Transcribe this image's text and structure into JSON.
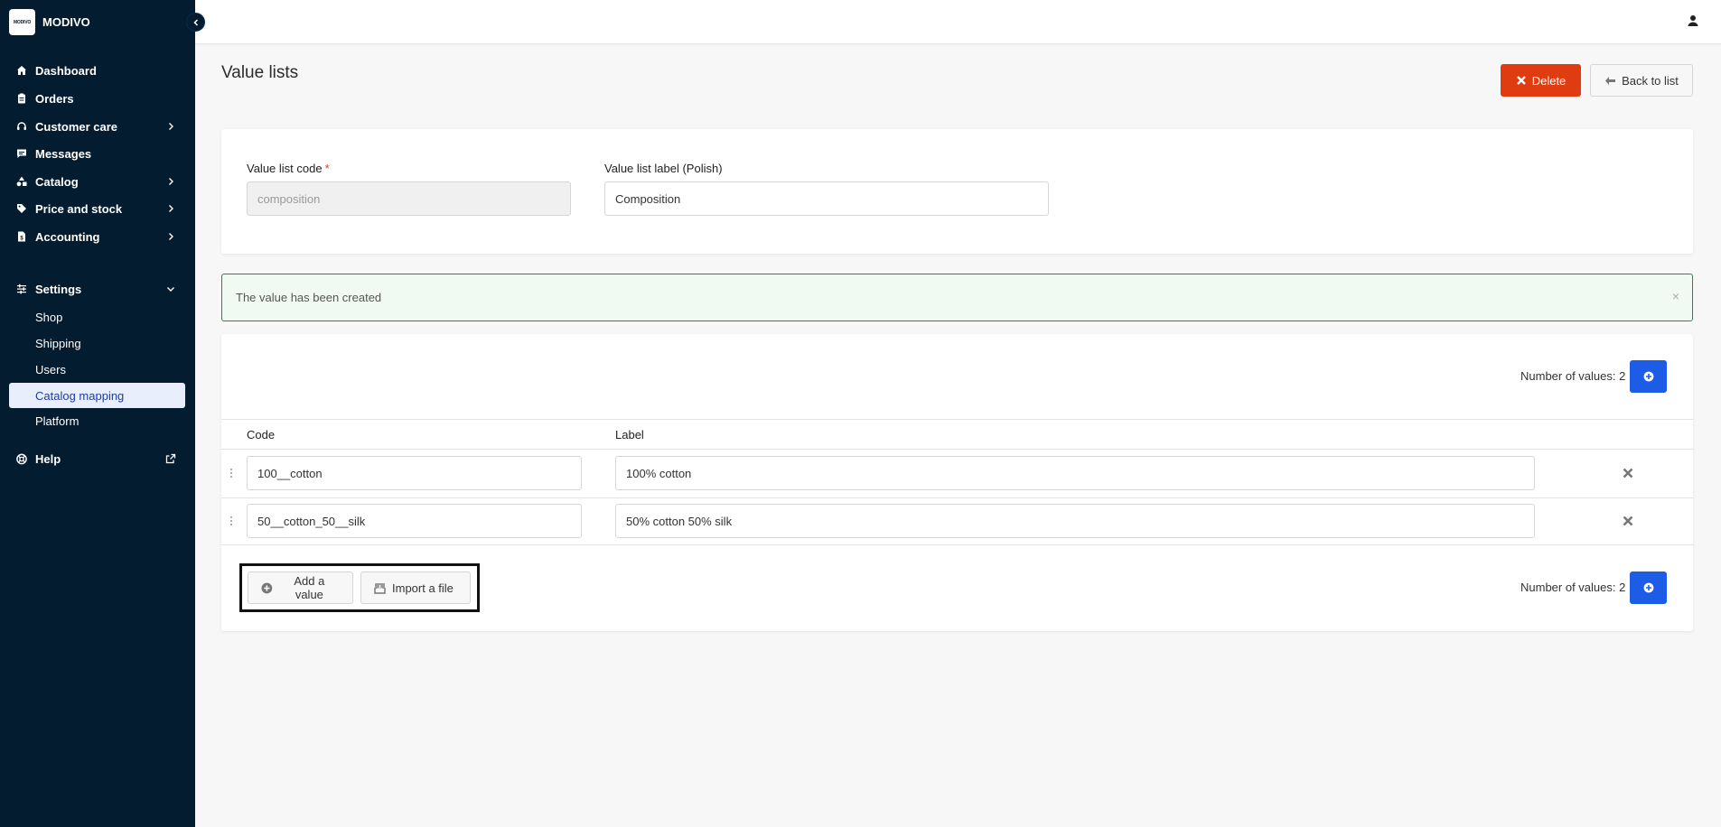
{
  "brand": {
    "logo_text": "MODIVO",
    "name": "MODIVO"
  },
  "sidebar": {
    "items": [
      {
        "label": "Dashboard",
        "icon": "home-icon"
      },
      {
        "label": "Orders",
        "icon": "clipboard-icon"
      },
      {
        "label": "Customer care",
        "icon": "headset-icon",
        "has_children": true
      },
      {
        "label": "Messages",
        "icon": "chat-icon"
      },
      {
        "label": "Catalog",
        "icon": "shapes-icon",
        "has_children": true
      },
      {
        "label": "Price and stock",
        "icon": "tag-icon",
        "has_children": true
      },
      {
        "label": "Accounting",
        "icon": "invoice-icon",
        "has_children": true
      }
    ],
    "settings": {
      "label": "Settings",
      "icon": "sliders-icon",
      "expanded": true,
      "children": [
        "Shop",
        "Shipping",
        "Users",
        "Catalog mapping",
        "Platform"
      ],
      "active": "Catalog mapping"
    },
    "help": {
      "label": "Help",
      "icon": "lifebuoy-icon"
    }
  },
  "page": {
    "title": "Value lists",
    "delete_label": "Delete",
    "back_label": "Back to list"
  },
  "form": {
    "code_label": "Value list code",
    "code_value": "composition",
    "label_label": "Value list label (Polish)",
    "label_value": "Composition"
  },
  "alert": {
    "text": "The value has been created",
    "close": "×"
  },
  "values_table": {
    "count_text": "Number of values: 2",
    "columns": [
      "Code",
      "Label"
    ],
    "rows": [
      {
        "code": "100__cotton",
        "label": "100% cotton"
      },
      {
        "code": "50__cotton_50__silk",
        "label": "50% cotton 50% silk"
      }
    ],
    "add_value_label": "Add a value",
    "import_label": "Import a file"
  },
  "colors": {
    "sidebar_bg": "#041c30",
    "danger": "#e03c12",
    "primary": "#1c5ce6",
    "success_border": "#2b8a3e",
    "active_nav_bg": "#e8eefb"
  }
}
